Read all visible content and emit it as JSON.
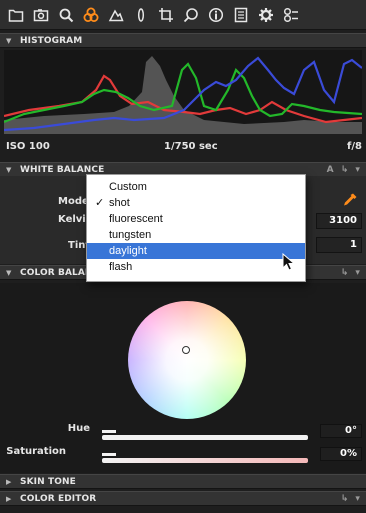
{
  "toolbar": {
    "tools": [
      {
        "icon": "folder-icon",
        "active": false
      },
      {
        "icon": "camera-icon",
        "active": false
      },
      {
        "icon": "magnifier-icon",
        "active": false
      },
      {
        "icon": "color-circles-icon",
        "active": true
      },
      {
        "icon": "exposure-triangle-icon",
        "active": false
      },
      {
        "icon": "lens-icon",
        "active": false
      },
      {
        "icon": "crop-icon",
        "active": false
      },
      {
        "icon": "spot-tool-icon",
        "active": false
      },
      {
        "icon": "info-icon",
        "active": false
      },
      {
        "icon": "metadata-icon",
        "active": false
      },
      {
        "icon": "gear-icon",
        "active": false
      },
      {
        "icon": "keystone-icon",
        "active": false
      }
    ]
  },
  "histogram": {
    "title": "HISTOGRAM",
    "iso": "ISO 100",
    "shutter": "1/750 sec",
    "aperture": "f/8"
  },
  "white_balance": {
    "title": "WHITE BALANCE",
    "header_right": "A",
    "mode_label": "Mode",
    "kelvin_label": "Kelvin",
    "tint_label": "Tint",
    "kelvin_value": "3100",
    "tint_value": "1",
    "mode_options": [
      "Custom",
      "shot",
      "fluorescent",
      "tungsten",
      "daylight",
      "flash"
    ],
    "checked_option": "shot",
    "highlighted_option": "daylight"
  },
  "color_balance": {
    "title": "COLOR BALANCE",
    "hue_label": "Hue",
    "hue_value": "0°",
    "saturation_label": "Saturation",
    "saturation_value": "0%"
  },
  "skin_tone": {
    "title": "SKIN TONE"
  },
  "color_editor": {
    "title": "COLOR EDITOR"
  },
  "colors": {
    "accent": "#ff8c1a",
    "selection": "#3875d7",
    "panel": "#2a2a2a"
  }
}
